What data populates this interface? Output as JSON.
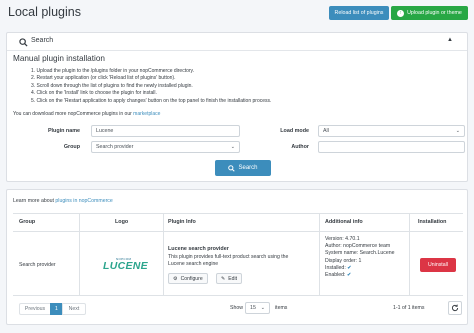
{
  "header": {
    "title": "Local plugins",
    "reload_label": "Reload list of plugins",
    "upload_label": "Upload plugin or theme"
  },
  "search_panel": {
    "label": "Search",
    "manual_title": "Manual plugin installation",
    "steps": [
      "1. Upload the plugin to the /plugins folder in your nopCommerce directory.",
      "2. Restart your application (or click 'Reload list of plugins' button).",
      "3. Scroll down through the list of plugins to find the newly installed plugin.",
      "4. Click on the 'Install' link to choose the plugin for install.",
      "5. Click on the 'Restart application to apply changes' button on the top panel to finish the installation process."
    ],
    "download_text": "You can download more nopCommerce plugins in our",
    "download_link": "marketplace",
    "plugin_name_label": "Plugin name",
    "plugin_name_value": "Lucene",
    "group_label": "Group",
    "group_placeholder": "Search provider",
    "load_mode_label": "Load mode",
    "load_mode_value": "All",
    "author_label": "Author",
    "author_placeholder": "",
    "search_button": "Search"
  },
  "table_panel": {
    "learn_more_text": "Learn more about",
    "learn_more_link": "plugins in nopCommerce",
    "columns": [
      "Group",
      "Logo",
      "Plugin Info",
      "Additional info",
      "Installation"
    ],
    "row": {
      "group": "Search provider",
      "logo_small": "NOPCOM",
      "logo_big": "LUCENE",
      "name": "Lucene search provider",
      "description": "This plugin provides full-text product search using the Lucene search engine",
      "configure": "Configure",
      "edit": "Edit",
      "version": "Version: 4.70.1",
      "author": "Author: nopCommerce team",
      "system_name": "System name: Search.Lucene",
      "display_order": "Display order: 1",
      "installed": "Installed:",
      "enabled": "Enabled:",
      "uninstall": "Uninstall"
    },
    "pager": {
      "previous": "Previous",
      "current": "1",
      "next": "Next",
      "show": "Show",
      "page_size": "15",
      "items": "items",
      "summary": "1-1 of 1 items"
    }
  },
  "colors": {
    "primary": "#3c8dbc",
    "success": "#28a745",
    "danger": "#dc3545",
    "logo_green": "#2ca58d"
  }
}
